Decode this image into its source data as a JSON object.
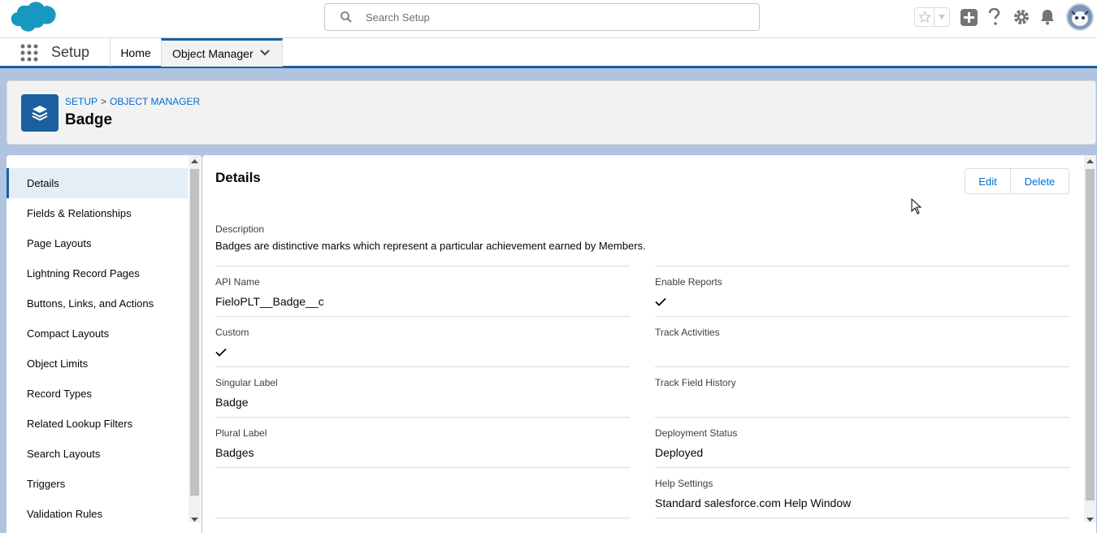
{
  "search": {
    "placeholder": "Search Setup"
  },
  "context_bar": {
    "app_name": "Setup",
    "tabs": [
      {
        "label": "Home"
      },
      {
        "label": "Object Manager"
      }
    ]
  },
  "page_header": {
    "breadcrumb": [
      "SETUP",
      "OBJECT MANAGER"
    ],
    "breadcrumb_sep": ">",
    "title": "Badge"
  },
  "left_nav": {
    "items": [
      {
        "label": "Details"
      },
      {
        "label": "Fields & Relationships"
      },
      {
        "label": "Page Layouts"
      },
      {
        "label": "Lightning Record Pages"
      },
      {
        "label": "Buttons, Links, and Actions"
      },
      {
        "label": "Compact Layouts"
      },
      {
        "label": "Object Limits"
      },
      {
        "label": "Record Types"
      },
      {
        "label": "Related Lookup Filters"
      },
      {
        "label": "Search Layouts"
      },
      {
        "label": "Triggers"
      },
      {
        "label": "Validation Rules"
      }
    ]
  },
  "details": {
    "title": "Details",
    "edit_label": "Edit",
    "delete_label": "Delete",
    "description_label": "Description",
    "description_value": "Badges are distinctive marks which represent a particular achievement earned by Members.",
    "left_fields": [
      {
        "label": "API Name",
        "value": "FieloPLT__Badge__c"
      },
      {
        "label": "Custom",
        "value": ""
      },
      {
        "label": "Singular Label",
        "value": "Badge"
      },
      {
        "label": "Plural Label",
        "value": "Badges"
      }
    ],
    "right_fields": [
      {
        "label": "Enable Reports",
        "value": ""
      },
      {
        "label": "Track Activities",
        "value": ""
      },
      {
        "label": "Track Field History",
        "value": ""
      },
      {
        "label": "Deployment Status",
        "value": "Deployed"
      },
      {
        "label": "Help Settings",
        "value": "Standard salesforce.com Help Window"
      }
    ]
  },
  "colors": {
    "brand": "#1b5f9e",
    "link": "#0070d2",
    "background": "#b0c4df"
  }
}
